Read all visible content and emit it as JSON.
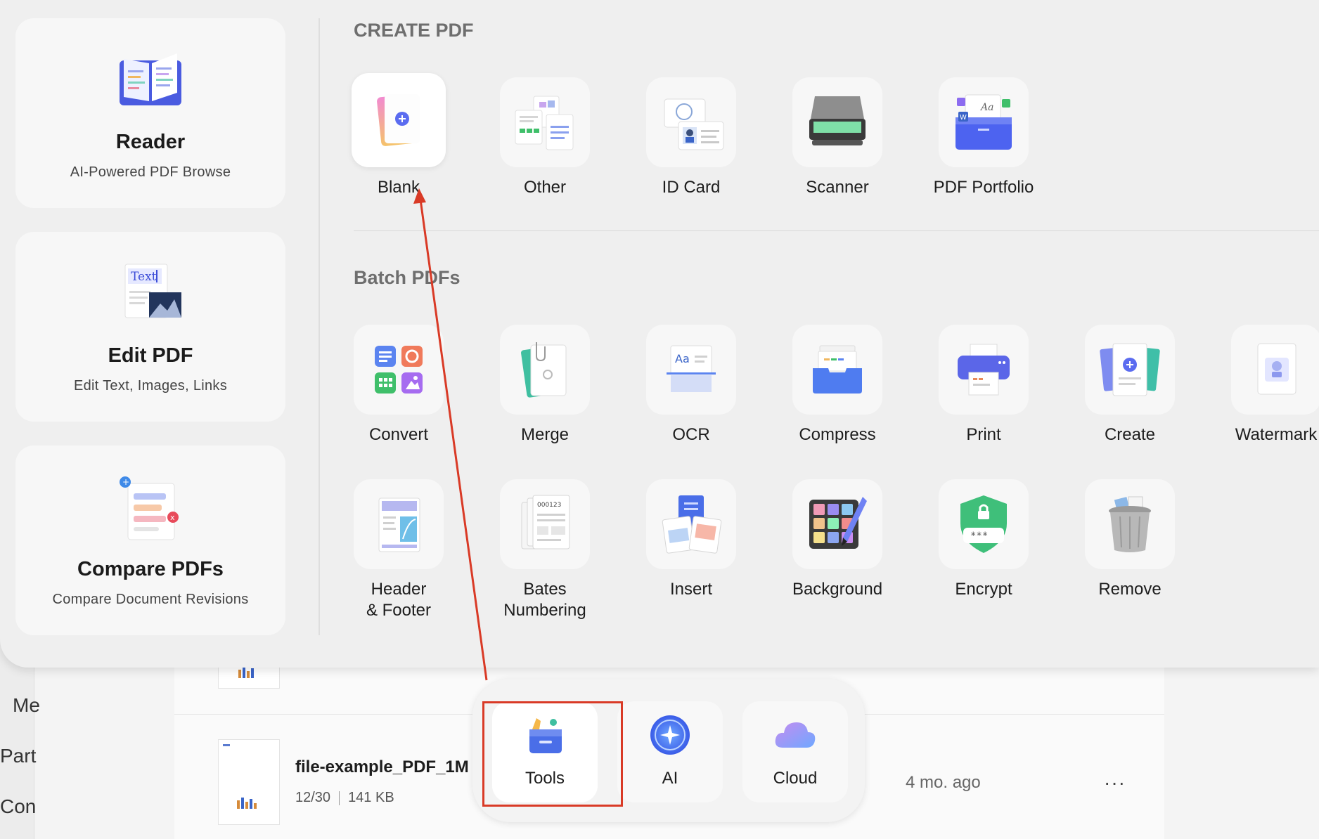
{
  "background": {
    "sidebar_fragments": [
      "Me",
      "Part",
      "Con"
    ],
    "file": {
      "name": "file-example_PDF_1M",
      "pages": "12/30",
      "size": "141 KB",
      "modified": "4 mo. ago",
      "more": "···"
    }
  },
  "side_cards": [
    {
      "title": "Reader",
      "subtitle": "AI-Powered PDF Browse",
      "icon": "book-icon"
    },
    {
      "title": "Edit PDF",
      "subtitle": "Edit Text, Images, Links",
      "icon_text": "Text",
      "icon": "edit-text-icon"
    },
    {
      "title": "Compare PDFs",
      "subtitle": "Compare Document Revisions",
      "icon": "compare-icon"
    }
  ],
  "create_pdf": {
    "title": "CREATE PDF",
    "items": [
      {
        "label": "Blank",
        "icon": "blank-page-icon"
      },
      {
        "label": "Other",
        "icon": "other-files-icon"
      },
      {
        "label": "ID Card",
        "icon": "id-card-icon"
      },
      {
        "label": "Scanner",
        "icon": "scanner-icon"
      },
      {
        "label": "PDF Portfolio",
        "icon": "portfolio-icon"
      }
    ]
  },
  "batch_pdfs": {
    "title": "Batch PDFs",
    "row1": [
      {
        "label": "Convert",
        "icon": "convert-icon"
      },
      {
        "label": "Merge",
        "icon": "merge-icon"
      },
      {
        "label": "OCR",
        "icon": "ocr-icon",
        "icon_text": "Aa"
      },
      {
        "label": "Compress",
        "icon": "compress-icon"
      },
      {
        "label": "Print",
        "icon": "print-icon"
      },
      {
        "label": "Create",
        "icon": "create-icon"
      },
      {
        "label": "Watermark",
        "icon": "watermark-icon"
      }
    ],
    "row2": [
      {
        "label": "Header",
        "label2": "& Footer",
        "icon": "header-footer-icon"
      },
      {
        "label": "Bates",
        "label2": "Numbering",
        "icon": "bates-icon",
        "icon_text": "000123"
      },
      {
        "label": "Insert",
        "icon": "insert-icon"
      },
      {
        "label": "Background",
        "icon": "background-icon"
      },
      {
        "label": "Encrypt",
        "icon": "encrypt-icon",
        "icon_text": "***"
      },
      {
        "label": "Remove",
        "icon": "trash-icon"
      }
    ]
  },
  "dock": {
    "items": [
      {
        "label": "Tools",
        "icon": "toolbox-icon",
        "active": true
      },
      {
        "label": "AI",
        "icon": "ai-icon"
      },
      {
        "label": "Cloud",
        "icon": "cloud-icon"
      }
    ]
  },
  "colors": {
    "accent_blue": "#5b6cf0",
    "annotation_red": "#d93a26"
  }
}
